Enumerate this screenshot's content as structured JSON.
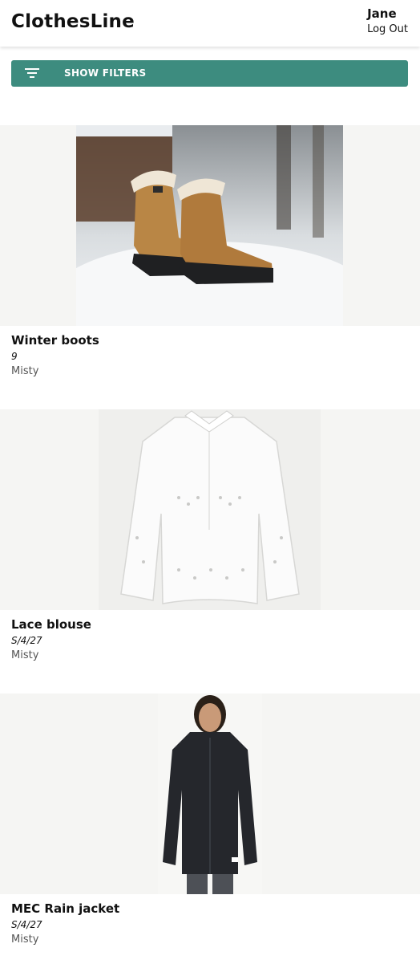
{
  "header": {
    "brand": "ClothesLine",
    "user_name": "Jane",
    "logout_label": "Log Out"
  },
  "filters": {
    "button_label": "SHOW FILTERS",
    "icon": "filter-icon"
  },
  "items": [
    {
      "title": "Winter boots",
      "size": "9",
      "owner": "Misty",
      "image": "winter-boots-photo"
    },
    {
      "title": "Lace blouse",
      "size": "S/4/27",
      "owner": "Misty",
      "image": "lace-blouse-photo"
    },
    {
      "title": "MEC Rain jacket",
      "size": "S/4/27",
      "owner": "Misty",
      "image": "rain-jacket-photo"
    }
  ]
}
